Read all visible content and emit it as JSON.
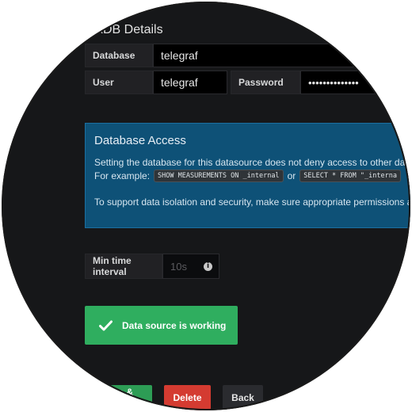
{
  "section": {
    "title": "xDB Details"
  },
  "fields": {
    "database": {
      "label": "Database",
      "value": "telegraf"
    },
    "user": {
      "label": "User",
      "value": "telegraf"
    },
    "password": {
      "label": "Password",
      "value": "••••••••••••••"
    }
  },
  "alert": {
    "title": "Database Access",
    "line1": "Setting the database for this datasource does not deny access to other data",
    "example_label": "For example:",
    "code1": "SHOW MEASUREMENTS ON _internal",
    "or_text": "or",
    "code2": "SELECT * FROM \"_interna",
    "line3": "To support data isolation and security, make sure appropriate permissions ar"
  },
  "min_interval": {
    "label": "Min time interval",
    "placeholder": "10s",
    "icon": "info-icon"
  },
  "status": {
    "text": "Data source is working",
    "icon": "check-icon",
    "color": "#2fae5f"
  },
  "buttons": {
    "save_label": "Save & Test",
    "delete_label": "Delete",
    "back_label": "Back"
  },
  "colors": {
    "background": "#161719",
    "alert_bg": "#0e5177",
    "success": "#2fae5f",
    "danger": "#d43b31",
    "secondary": "#2a2b2f"
  }
}
